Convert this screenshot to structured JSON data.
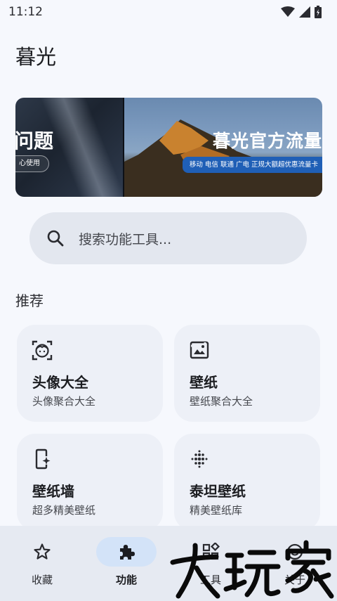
{
  "status_bar": {
    "time": "11:12"
  },
  "app": {
    "title": "暮光"
  },
  "banner": {
    "left_heading": "问题",
    "left_chip": "心使用",
    "right_heading": "暮光官方流量",
    "right_chip": "移动 电信 联通 广电 正规大额超优惠流量卡"
  },
  "search": {
    "placeholder": "搜索功能工具..."
  },
  "section": {
    "title": "推荐"
  },
  "cards": [
    {
      "title": "头像大全",
      "subtitle": "头像聚合大全",
      "icon": "face-icon"
    },
    {
      "title": "壁纸",
      "subtitle": "壁纸聚合大全",
      "icon": "image-icon"
    },
    {
      "title": "壁纸墙",
      "subtitle": "超多精美壁纸",
      "icon": "phone-sparkle-icon"
    },
    {
      "title": "泰坦壁纸",
      "subtitle": "精美壁纸库",
      "icon": "dot-grid-icon"
    }
  ],
  "bottom_nav": {
    "items": [
      {
        "label": "收藏",
        "icon": "star-icon",
        "active": false
      },
      {
        "label": "功能",
        "icon": "puzzle-icon",
        "active": true
      },
      {
        "label": "工具",
        "icon": "widgets-icon",
        "active": false
      },
      {
        "label": "关于",
        "icon": "smiley-icon",
        "active": false
      }
    ]
  },
  "watermark": {
    "text": "大玩家"
  }
}
